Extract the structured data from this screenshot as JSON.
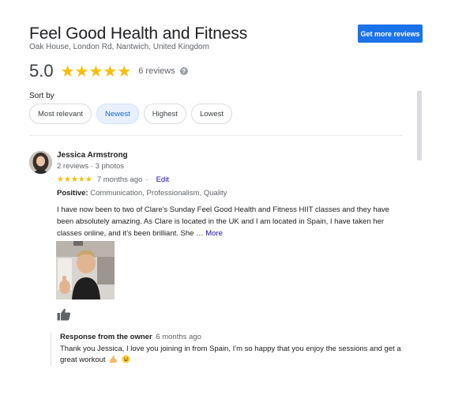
{
  "business": {
    "title": "Feel Good Health and Fitness",
    "address": "Oak House, London Rd, Nantwich, United Kingdom",
    "get_more_label": "Get more reviews"
  },
  "rating": {
    "value": "5.0",
    "stars": "★★★★★",
    "count_text": "6 reviews",
    "help_glyph": "?",
    "star_color": "#fbbc04"
  },
  "sort": {
    "label": "Sort by",
    "options": [
      "Most relevant",
      "Newest",
      "Highest",
      "Lowest"
    ],
    "selected": "Newest"
  },
  "review": {
    "author": "Jessica Armstrong",
    "meta": "2 reviews · 3 photos",
    "stars": "★★★★★",
    "time": "7 months ago",
    "separator": "·",
    "edit_label": "Edit",
    "positive_label": "Positive:",
    "positive_values": "Communication, Professionalism, Quality",
    "text": "I have now been to two of Clare's Sunday Feel Good Health and Fitness HIIT classes and they have been absolutely amazing. As Clare is located in the UK and I am located in Spain, I have taken her classes online, and it's been brilliant. She …",
    "more_label": "More",
    "like_icon": "thumbs-up-icon"
  },
  "owner_response": {
    "title": "Response from the owner",
    "date": "6 months ago",
    "text": "Thank you Jessica, I love you joining in from Spain, I'm so happy that you enjoy the sessions and get a great workout"
  },
  "colors": {
    "accent": "#1a73e8",
    "link": "#1a0dab",
    "chip_active_bg": "#e8f0fe"
  }
}
